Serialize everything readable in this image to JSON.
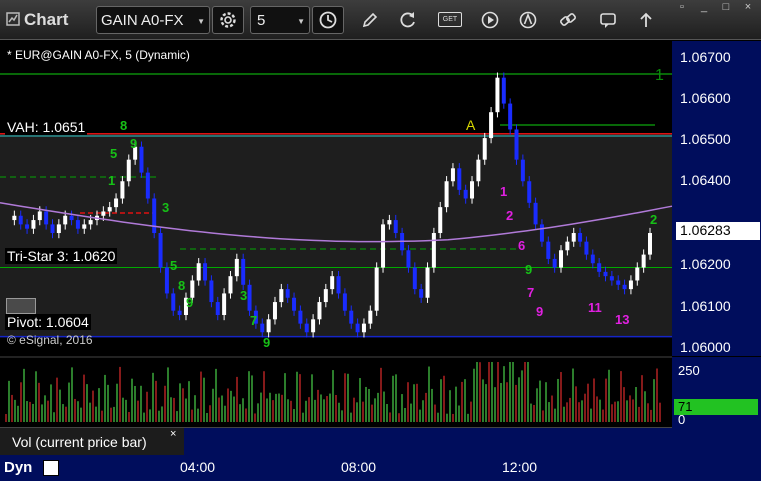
{
  "toolbar": {
    "title": "Chart",
    "symbol": "GAIN A0-FX",
    "interval": "5",
    "icons": [
      "chart-icon",
      "settings-icon",
      "clock-icon",
      "pencil-icon",
      "refresh-icon",
      "get-icon",
      "play-icon",
      "alert-icon",
      "link-icon",
      "message-icon",
      "arrow-up-icon"
    ],
    "get_label": "GET"
  },
  "chart": {
    "title": "* EUR@GAIN A0-FX, 5 (Dynamic)",
    "copyright": "© eSignal, 2016",
    "levels": [
      {
        "name": "vah",
        "label": "VAH: 1.0651",
        "price": 1.0651,
        "color": "#d11"
      },
      {
        "name": "tristar",
        "label": "Tri-Star 3: 1.0620",
        "price": 1.062,
        "color": "#0a0"
      },
      {
        "name": "pivot",
        "label": "Pivot: 1.0604",
        "price": 1.0604,
        "color": "#1525c8"
      }
    ],
    "last_price": "1.06283",
    "price_axis": {
      "ticks": [
        "1.06700",
        "1.06600",
        "1.06500",
        "1.06400",
        "1.06200",
        "1.06100",
        "1.06000"
      ],
      "values": [
        1.067,
        1.066,
        1.065,
        1.064,
        1.062,
        1.061,
        1.06
      ],
      "min": 1.05995,
      "max": 1.06725
    },
    "time_axis": {
      "ticks": [
        "04:00",
        "08:00",
        "12:00"
      ]
    },
    "annotation_a": "A",
    "annotation_1": "1"
  },
  "volume": {
    "panel_label": "Vol (current price bar)",
    "close": "×",
    "ticks": [
      "250",
      "0"
    ],
    "current": "71"
  },
  "footer": {
    "dyn_label": "Dyn"
  },
  "colors": {
    "axis_bg": "#000d5c",
    "up_candle": "#ffffff",
    "down_candle": "#1a2cff",
    "vwap": "#b07ad8",
    "count_green": "#17c017",
    "count_magenta": "#e020e0"
  }
}
